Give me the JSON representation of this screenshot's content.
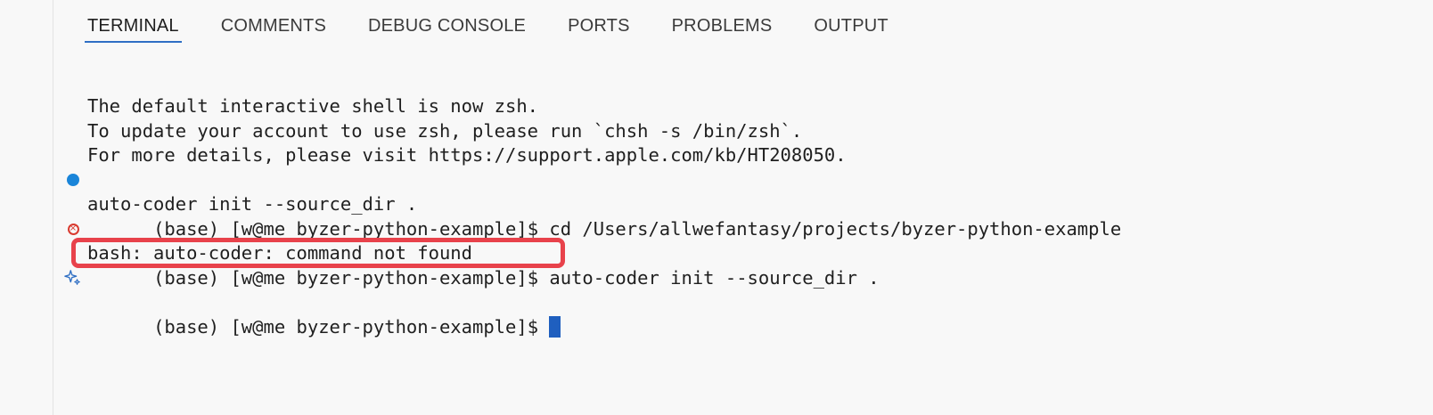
{
  "tabs": {
    "terminal": "TERMINAL",
    "comments": "COMMENTS",
    "debug_console": "DEBUG CONSOLE",
    "ports": "PORTS",
    "problems": "PROBLEMS",
    "output": "OUTPUT"
  },
  "terminal": {
    "lines": [
      "The default interactive shell is now zsh.",
      "To update your account to use zsh, please run `chsh -s /bin/zsh`.",
      "For more details, please visit https://support.apple.com/kb/HT208050.",
      "(base) [w@me byzer-python-example]$ cd /Users/allwefantasy/projects/byzer-python-example",
      "auto-coder init --source_dir .",
      "(base) [w@me byzer-python-example]$ auto-coder init --source_dir .",
      "bash: auto-coder: command not found",
      "(base) [w@me byzer-python-example]$ "
    ]
  },
  "colors": {
    "accent": "#2f6fc4",
    "success_dot": "#1a85d9",
    "error": "#d93a2f",
    "highlight_box": "#e8424b",
    "cursor": "#1f5fbf"
  },
  "icons": {
    "line4": "success-dot-icon",
    "line6": "error-circle-icon",
    "line8": "sparkle-icon"
  }
}
